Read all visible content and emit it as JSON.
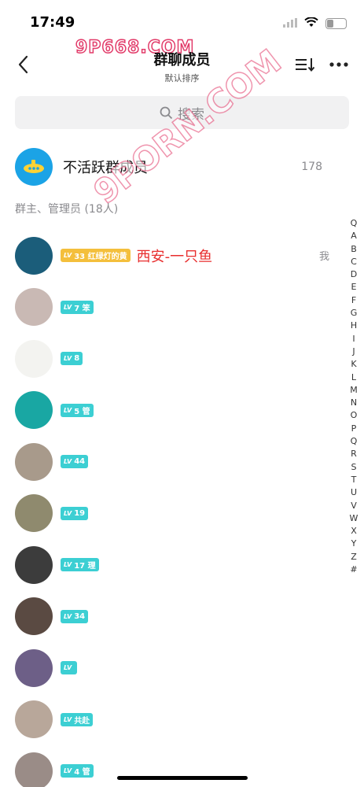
{
  "status_bar": {
    "time": "17:49",
    "battery": "5"
  },
  "watermarks": {
    "top": "9P668.COM",
    "diagonal": "9PORN.COM"
  },
  "nav": {
    "title": "群聊成员",
    "subtitle": "默认排序"
  },
  "search": {
    "placeholder": "搜索"
  },
  "inactive": {
    "label": "不活跃群成员",
    "count": "178"
  },
  "section": {
    "header": "群主、管理员 (18人)"
  },
  "members": [
    {
      "lv": "33",
      "badge_text": "红绿灯的黄",
      "name": "西安-一只鱼",
      "me": "我",
      "owner": true,
      "avatar_color": "#1b5d7a"
    },
    {
      "lv": "7",
      "badge_text": "笨",
      "name": "",
      "me": "",
      "owner": false,
      "avatar_color": "#c9b9b4"
    },
    {
      "lv": "8",
      "badge_text": "",
      "name": "",
      "me": "",
      "owner": false,
      "avatar_color": "#f3f3f0"
    },
    {
      "lv": "5",
      "badge_text": "管",
      "name": "",
      "me": "",
      "owner": false,
      "avatar_color": "#19a7a3"
    },
    {
      "lv": "44",
      "badge_text": "",
      "name": "",
      "me": "",
      "owner": false,
      "avatar_color": "#a89a8b"
    },
    {
      "lv": "19",
      "badge_text": "",
      "name": "",
      "me": "",
      "owner": false,
      "avatar_color": "#8f8a6e"
    },
    {
      "lv": "17",
      "badge_text": "理",
      "name": "",
      "me": "",
      "owner": false,
      "avatar_color": "#3c3c3c"
    },
    {
      "lv": "34",
      "badge_text": "",
      "name": "",
      "me": "",
      "owner": false,
      "avatar_color": "#5a4a42"
    },
    {
      "lv": "",
      "badge_text": "",
      "name": "",
      "me": "",
      "owner": false,
      "avatar_color": "#6d5f87"
    },
    {
      "lv": "",
      "badge_text": "共赴",
      "name": "",
      "me": "",
      "owner": false,
      "avatar_color": "#b8a79a"
    },
    {
      "lv": "4",
      "badge_text": "管",
      "name": "",
      "me": "",
      "owner": false,
      "avatar_color": "#9a8c87"
    }
  ],
  "index_letters": [
    "Q",
    "A",
    "B",
    "C",
    "D",
    "E",
    "F",
    "G",
    "H",
    "I",
    "J",
    "K",
    "L",
    "M",
    "N",
    "O",
    "P",
    "Q",
    "R",
    "S",
    "T",
    "U",
    "V",
    "W",
    "X",
    "Y",
    "Z",
    "#"
  ],
  "colors": {
    "accent_teal": "#3ccfd3",
    "owner_gold": "#f4bf3c",
    "name_red": "#e82e2e",
    "inactive_blue": "#1ba3e6"
  }
}
